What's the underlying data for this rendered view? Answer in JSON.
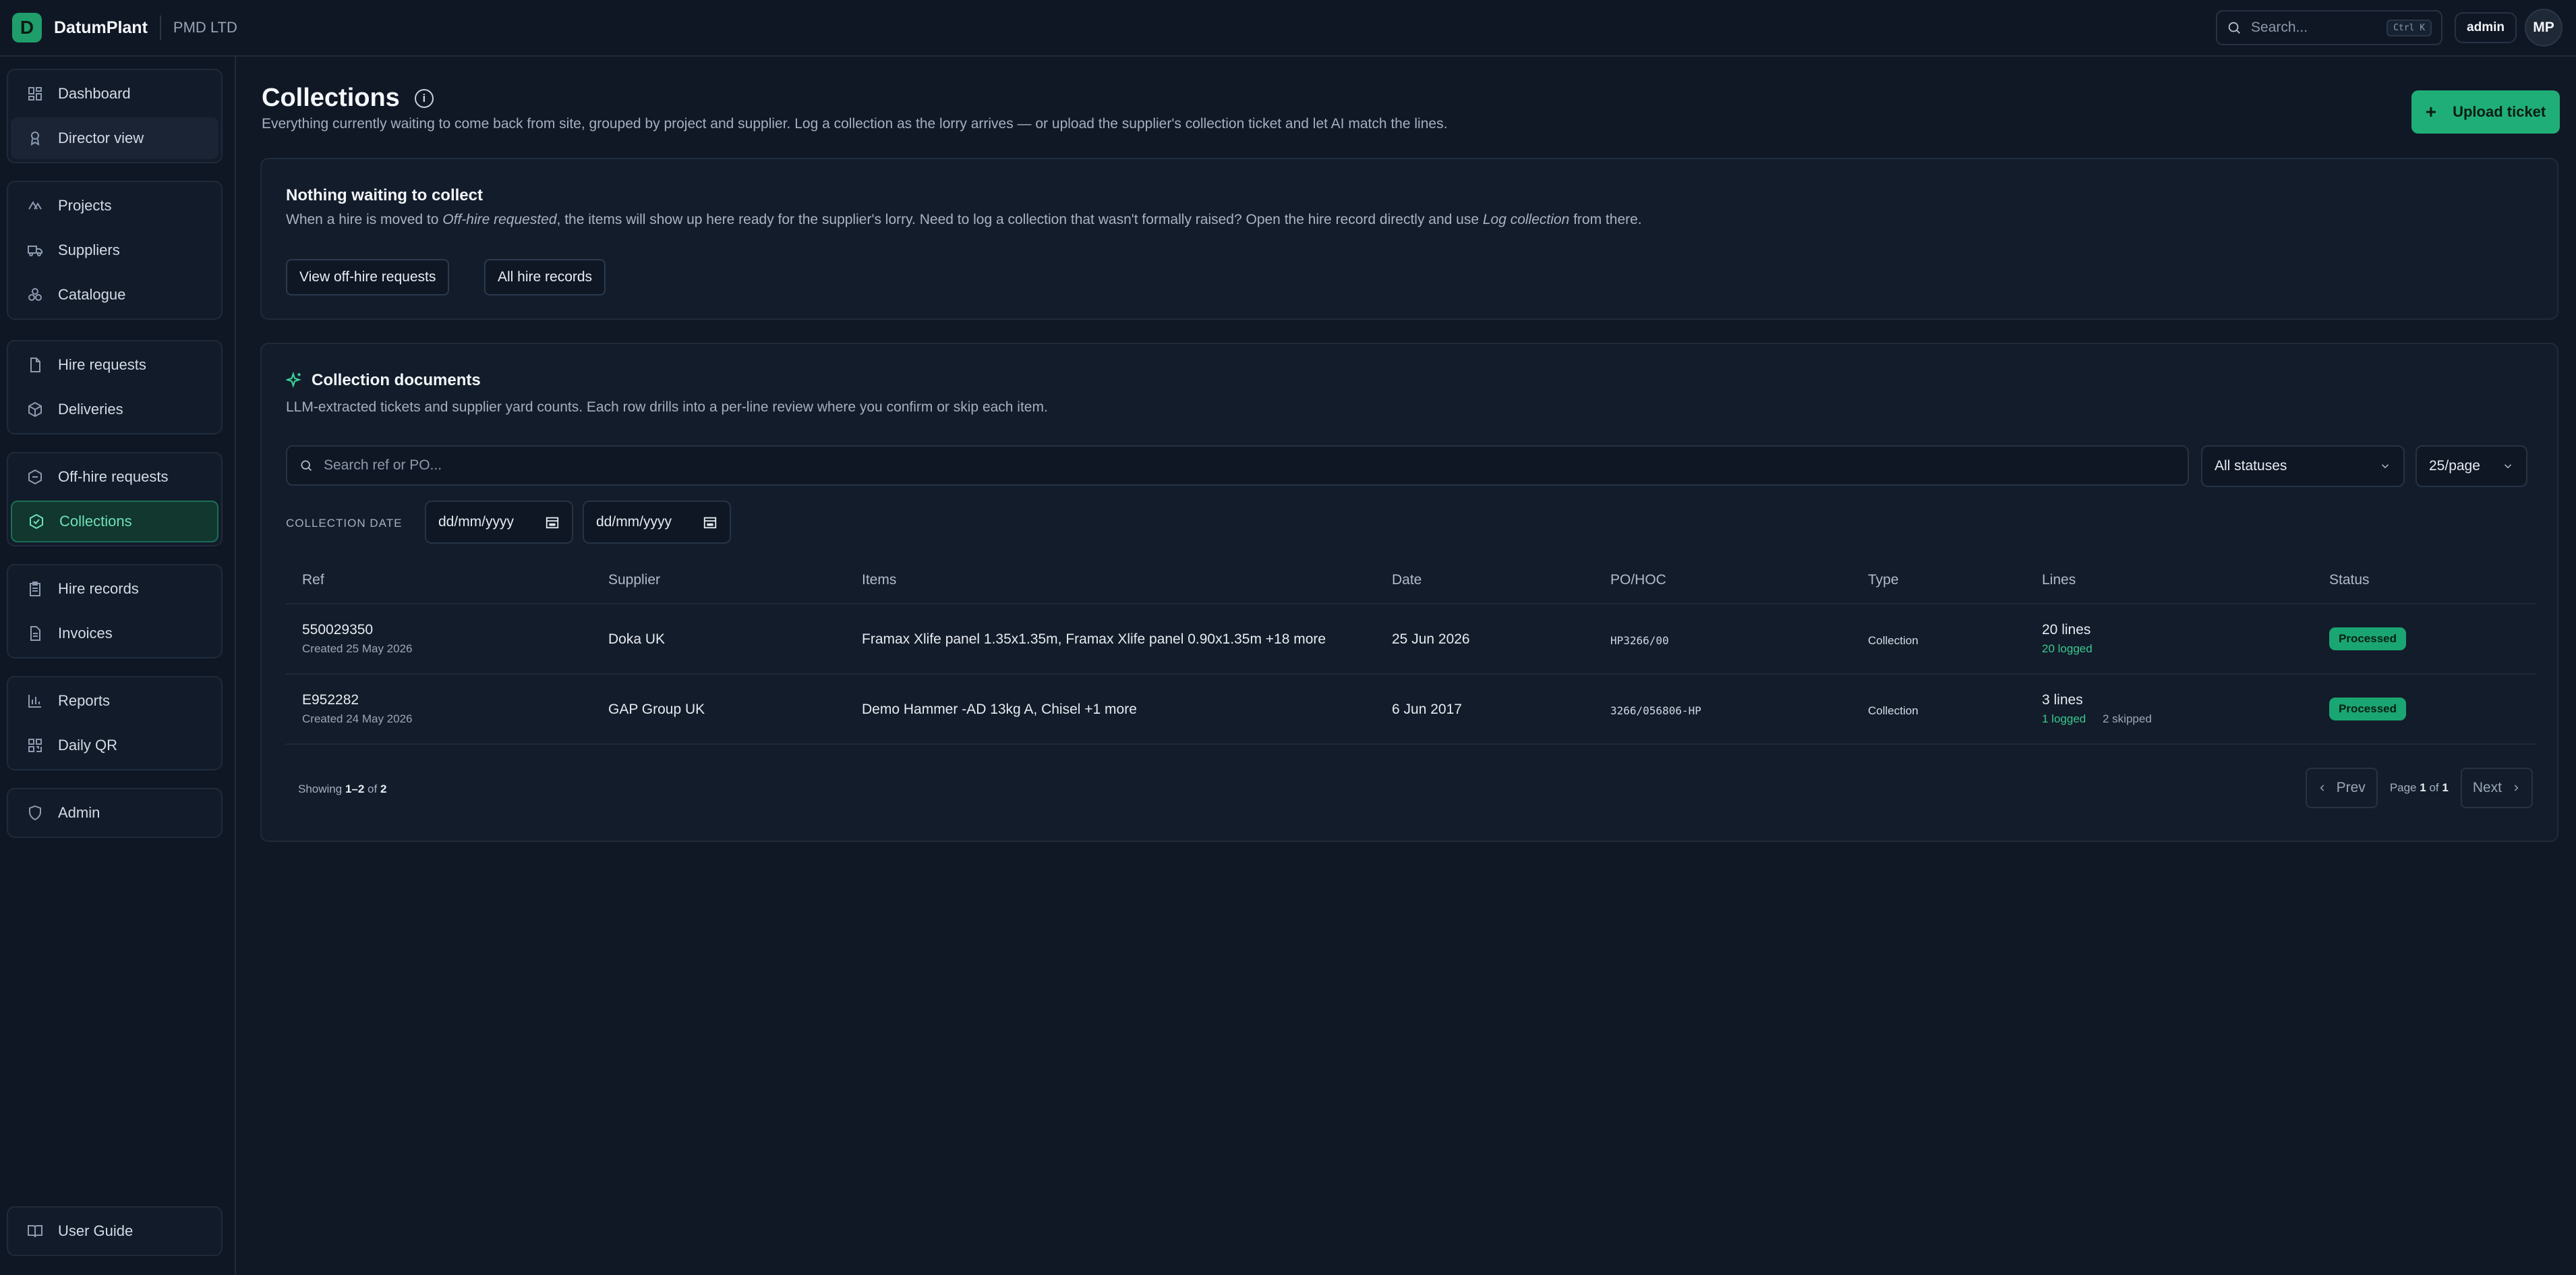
{
  "topbar": {
    "brand_initial": "D",
    "brand_name": "DatumPlant",
    "org": "PMD LTD",
    "search_placeholder": "Search...",
    "shortcut": "Ctrl K",
    "user": "admin",
    "avatar": "MP"
  },
  "sidebar": {
    "groups": [
      [
        {
          "label": "Dashboard",
          "icon": "dashboard-icon"
        },
        {
          "label": "Director view",
          "icon": "director-icon"
        }
      ],
      [
        {
          "label": "Projects",
          "icon": "projects-icon"
        },
        {
          "label": "Suppliers",
          "icon": "truck-icon"
        },
        {
          "label": "Catalogue",
          "icon": "catalogue-icon"
        }
      ],
      [
        {
          "label": "Hire requests",
          "icon": "document-icon"
        },
        {
          "label": "Deliveries",
          "icon": "box-icon"
        }
      ],
      [
        {
          "label": "Off-hire requests",
          "icon": "offhire-icon"
        },
        {
          "label": "Collections",
          "icon": "collections-icon"
        }
      ],
      [
        {
          "label": "Hire records",
          "icon": "clipboard-icon"
        },
        {
          "label": "Invoices",
          "icon": "invoice-icon"
        }
      ],
      [
        {
          "label": "Reports",
          "icon": "chart-icon"
        },
        {
          "label": "Daily QR",
          "icon": "qr-icon"
        }
      ],
      [
        {
          "label": "Admin",
          "icon": "shield-icon"
        }
      ]
    ],
    "footer": {
      "label": "User Guide",
      "icon": "book-icon"
    }
  },
  "page": {
    "title": "Collections",
    "subtitle": "Everything currently waiting to come back from site, grouped by project and supplier. Log a collection as the lorry arrives — or upload the supplier's collection ticket and let AI match the lines.",
    "upload_label": "Upload ticket"
  },
  "empty": {
    "title": "Nothing waiting to collect",
    "desc_pre": "When a hire is moved to ",
    "desc_em1": "Off-hire requested",
    "desc_mid": ", the items will show up here ready for the supplier's lorry. Need to log a collection that wasn't formally raised? Open the hire record directly and use ",
    "desc_em2": "Log collection",
    "desc_post": " from there.",
    "btn1": "View off-hire requests",
    "btn2": "All hire records"
  },
  "docs": {
    "title": "Collection documents",
    "subtitle": "LLM-extracted tickets and supplier yard counts. Each row drills into a per-line review where you confirm or skip each item.",
    "search_placeholder": "Search ref or PO...",
    "status_filter": "All statuses",
    "per_page": "25/page",
    "date_label": "COLLECTION DATE",
    "date_from": "dd/mm/yyyy",
    "date_to": "dd/mm/yyyy",
    "columns": [
      "Ref",
      "Supplier",
      "Items",
      "Date",
      "PO/HOC",
      "Type",
      "Lines",
      "Status"
    ],
    "rows": [
      {
        "ref": "550029350",
        "created": "Created 25 May 2026",
        "supplier": "Doka UK",
        "items": "Framax Xlife panel 1.35x1.35m, Framax Xlife panel 0.90x1.35m +18 more",
        "date": "25 Jun 2026",
        "po": "HP3266/00",
        "type": "Collection",
        "lines": "20 lines",
        "logged": "20 logged",
        "skipped": "",
        "status": "Processed"
      },
      {
        "ref": "E952282",
        "created": "Created 24 May 2026",
        "supplier": "GAP Group UK",
        "items": "Demo Hammer -AD 13kg A, Chisel +1 more",
        "date": "6 Jun 2017",
        "po": "3266/056806-HP",
        "type": "Collection",
        "lines": "3 lines",
        "logged": "1 logged",
        "skipped": "2 skipped",
        "status": "Processed"
      }
    ],
    "footer": {
      "showing_pre": "Showing ",
      "range": "1–2",
      "of": " of ",
      "total": "2"
    },
    "pager": {
      "prev": "Prev",
      "page_pre": "Page ",
      "page": "1",
      "of": " of ",
      "pages": "1",
      "next": "Next"
    }
  },
  "colors": {
    "accent": "#1fae77",
    "background": "#101826",
    "card": "#131c2a"
  }
}
